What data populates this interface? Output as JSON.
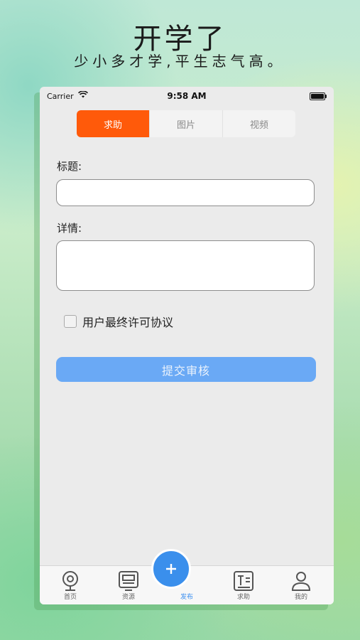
{
  "promo": {
    "title": "开学了",
    "subtitle": "少小多才学,平生志气高。"
  },
  "status_bar": {
    "carrier": "Carrier",
    "time": "9:58 AM"
  },
  "segments": [
    {
      "label": "求助",
      "active": true
    },
    {
      "label": "图片",
      "active": false
    },
    {
      "label": "视频",
      "active": false
    }
  ],
  "form": {
    "title_label": "标题:",
    "title_value": "",
    "detail_label": "详情:",
    "detail_value": "",
    "agreement_label": "用户最终许可协议",
    "agreement_checked": false,
    "submit_label": "提交审核"
  },
  "tabbar": {
    "items": [
      {
        "label": "首页",
        "icon": "webcam-icon"
      },
      {
        "label": "资源",
        "icon": "monitor-icon"
      },
      {
        "label": "发布",
        "icon": "plus-icon"
      },
      {
        "label": "求助",
        "icon": "text-icon"
      },
      {
        "label": "我的",
        "icon": "user-icon"
      }
    ]
  },
  "colors": {
    "accent_orange": "#ff5a0a",
    "submit_blue": "#6aa9f5",
    "fab_blue": "#3a8fec"
  }
}
